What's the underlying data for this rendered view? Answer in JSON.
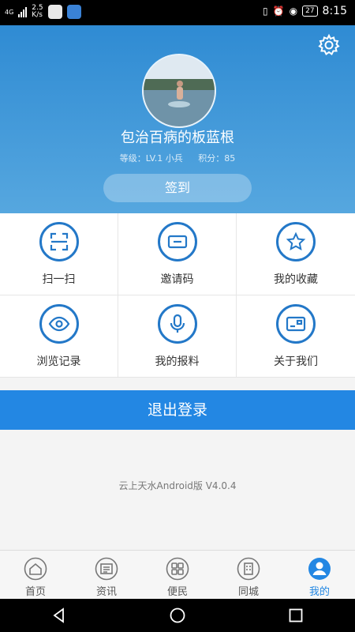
{
  "status_bar": {
    "network": "4G",
    "speed_value": "2.5",
    "speed_unit": "K/s",
    "battery": "27",
    "time": "8:15"
  },
  "profile": {
    "username": "包治百病的板蓝根",
    "level": "等级：LV.1 小兵",
    "points": "积分：85",
    "checkin_label": "签到"
  },
  "menu": {
    "scan": "扫一扫",
    "invite": "邀请码",
    "favorites": "我的收藏",
    "history": "浏览记录",
    "report": "我的报料",
    "about": "关于我们"
  },
  "logout_label": "退出登录",
  "version": "云上天水Android版 V4.0.4",
  "tabs": {
    "home": "首页",
    "news": "资讯",
    "service": "便民",
    "city": "同城",
    "mine": "我的"
  },
  "colors": {
    "accent": "#2387e3",
    "header_top": "#2f8bd3",
    "header_bottom": "#56a7df",
    "icon_blue": "#2378c8"
  }
}
